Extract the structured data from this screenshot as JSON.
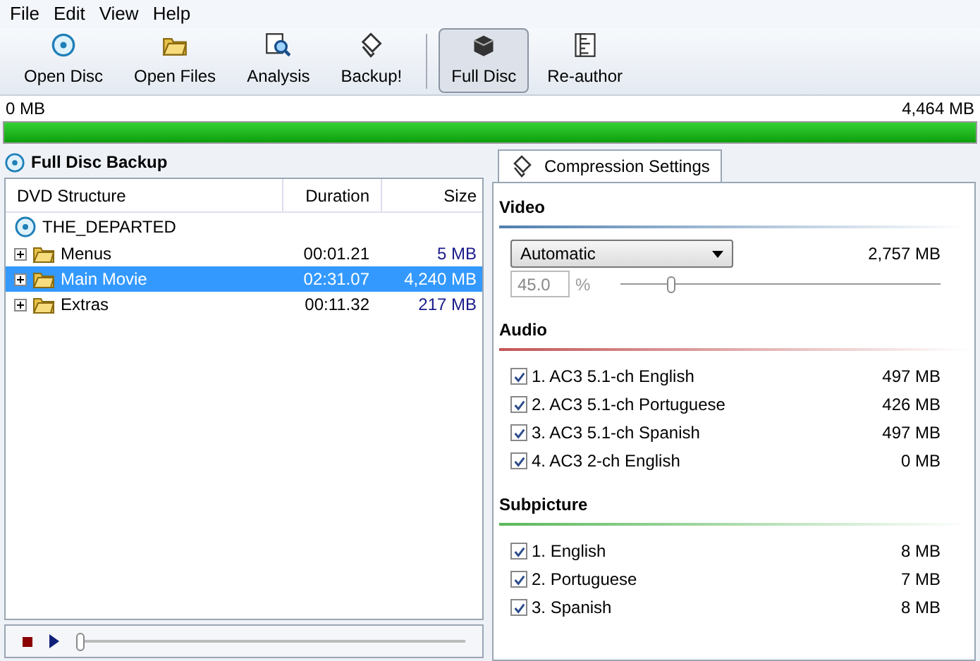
{
  "menu": [
    "File",
    "Edit",
    "View",
    "Help"
  ],
  "toolbar": [
    {
      "label": "Open Disc",
      "selected": false
    },
    {
      "label": "Open Files",
      "selected": false
    },
    {
      "label": "Analysis",
      "selected": false
    },
    {
      "label": "Backup!",
      "selected": false
    },
    {
      "label": "Full Disc",
      "selected": true
    },
    {
      "label": "Re-author",
      "selected": false
    }
  ],
  "capacity": {
    "used": "0 MB",
    "total": "4,464 MB",
    "level": 1
  },
  "left_panel": {
    "title": "Full Disc Backup",
    "columns": [
      "DVD Structure",
      "Duration",
      "Size"
    ],
    "tree": [
      {
        "name": "THE_DEPARTED",
        "kind": "disc",
        "children": [
          {
            "name": "Menus",
            "kind": "folder",
            "expanded": false,
            "selected": false,
            "duration": "00:01.21",
            "size": "5 MB"
          },
          {
            "name": "Main Movie",
            "kind": "folder",
            "expanded": false,
            "selected": true,
            "duration": "02:31.07",
            "size": "4,240 MB"
          },
          {
            "name": "Extras",
            "kind": "folder",
            "expanded": false,
            "selected": false,
            "duration": "00:11.32",
            "size": "217 MB"
          }
        ]
      }
    ],
    "player": {
      "level": 0
    }
  },
  "right_panel": {
    "tab": "Compression Settings",
    "video": {
      "heading": "Video",
      "mode": "Automatic",
      "size": "2,757 MB",
      "percent": "45.0",
      "percent_unit": "%",
      "level": 0.15
    },
    "audio": {
      "heading": "Audio",
      "tracks": [
        {
          "label": "1. AC3 5.1-ch English",
          "size": "497 MB",
          "checked": true
        },
        {
          "label": "2. AC3 5.1-ch Portuguese",
          "size": "426 MB",
          "checked": true
        },
        {
          "label": "3. AC3 5.1-ch Spanish",
          "size": "497 MB",
          "checked": true
        },
        {
          "label": "4. AC3 2-ch English",
          "size": "0 MB",
          "checked": true
        }
      ]
    },
    "subpicture": {
      "heading": "Subpicture",
      "tracks": [
        {
          "label": "1. English",
          "size": "8 MB",
          "checked": true
        },
        {
          "label": "2. Portuguese",
          "size": "7 MB",
          "checked": true
        },
        {
          "label": "3. Spanish",
          "size": "8 MB",
          "checked": true
        }
      ]
    }
  }
}
